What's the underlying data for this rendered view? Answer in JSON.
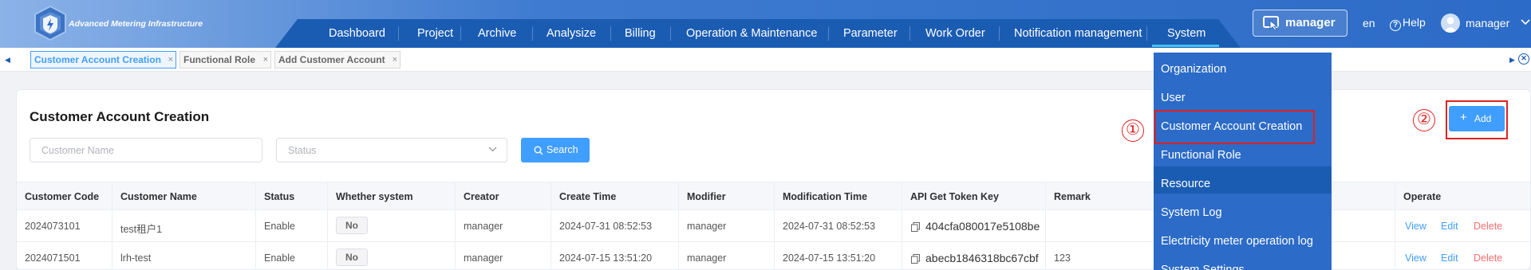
{
  "brand": {
    "name": "Advanced Metering Infrastructure"
  },
  "nav": {
    "items": [
      "Dashboard",
      "Project",
      "Archive",
      "Analysize",
      "Billing",
      "Operation & Maintenance",
      "Parameter",
      "Work Order",
      "Notification management",
      "System"
    ],
    "active": "System"
  },
  "header": {
    "role_label": "manager",
    "language": "en",
    "help": "Help",
    "user": "manager"
  },
  "tabs": [
    {
      "label": "Customer Account Creation",
      "active": true
    },
    {
      "label": "Functional Role",
      "active": false
    },
    {
      "label": "Add Customer Account",
      "active": false
    }
  ],
  "page": {
    "title": "Customer Account Creation",
    "name_placeholder": "Customer Name",
    "status_placeholder": "Status",
    "search_label": "Search",
    "add_label": "Add"
  },
  "annotations": {
    "one": "①",
    "two": "②"
  },
  "table": {
    "headers": [
      "Customer Code",
      "Customer Name",
      "Status",
      "Whether system",
      "Creator",
      "Create Time",
      "Modifier",
      "Modification Time",
      "API Get Token Key",
      "Remark",
      "Operate"
    ],
    "rows": [
      {
        "code": "2024073101",
        "name": "test租户1",
        "status": "Enable",
        "system": "No",
        "creator": "manager",
        "create_time": "2024-07-31 08:52:53",
        "modifier": "manager",
        "mod_time": "2024-07-31 08:52:53",
        "token": "404cfa080017e5108be",
        "remark": ""
      },
      {
        "code": "2024071501",
        "name": "lrh-test",
        "status": "Enable",
        "system": "No",
        "creator": "manager",
        "create_time": "2024-07-15 13:51:20",
        "modifier": "manager",
        "mod_time": "2024-07-15 13:51:20",
        "token": "abecb1846318bc67cbf",
        "remark": "123"
      }
    ],
    "ops": {
      "view": "View",
      "edit": "Edit",
      "delete": "Delete"
    }
  },
  "system_menu": [
    "Organization",
    "User",
    "Customer Account Creation",
    "Functional Role",
    "Resource",
    "System Log",
    "Electricity meter operation log",
    "System Settings"
  ],
  "colors": {
    "primary": "#409eff",
    "nav_dark": "#1b5cb3",
    "menu_bg": "#2c6bc7",
    "highlight_red": "#e02020",
    "delete_red": "#f56c6c"
  },
  "icons": {
    "logo": "shield-logo-icon",
    "role": "cursor-window-icon",
    "help": "question-circle-icon",
    "search": "search-icon",
    "add": "plus-icon",
    "copy": "copy-icon"
  }
}
